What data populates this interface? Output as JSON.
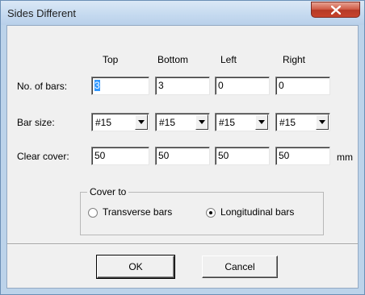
{
  "window": {
    "title": "Sides Different",
    "close_icon": "close-x-icon"
  },
  "columns": [
    "Top",
    "Bottom",
    "Left",
    "Right"
  ],
  "rows": {
    "bars": {
      "label": "No. of bars:",
      "values": [
        "3",
        "3",
        "0",
        "0"
      ]
    },
    "size": {
      "label": "Bar size:",
      "values": [
        "#15",
        "#15",
        "#15",
        "#15"
      ]
    },
    "cover": {
      "label": "Clear cover:",
      "values": [
        "50",
        "50",
        "50",
        "50"
      ],
      "unit": "mm"
    }
  },
  "cover_to": {
    "legend": "Cover to",
    "options": [
      "Transverse bars",
      "Longitudinal bars"
    ],
    "selected": "Longitudinal bars"
  },
  "buttons": {
    "ok": "OK",
    "cancel": "Cancel"
  }
}
